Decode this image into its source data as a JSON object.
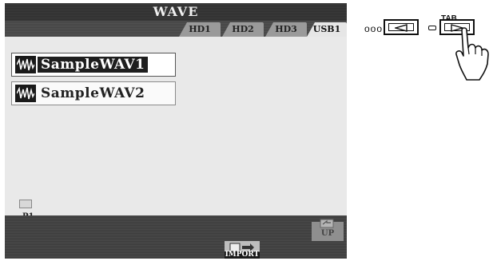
{
  "window": {
    "title": "WAVE"
  },
  "tabs": [
    "HD1",
    "HD2",
    "HD3",
    "USB1"
  ],
  "active_tab": "USB1",
  "files": [
    {
      "name": "SampleWAV1",
      "icon": "waveform-icon",
      "selected": true
    },
    {
      "name": "SampleWAV2",
      "icon": "waveform-icon",
      "selected": false
    }
  ],
  "page_tab": {
    "label": "P1"
  },
  "buttons": {
    "up_label": "UP",
    "import_label": "IMPORT"
  },
  "tab_control": {
    "caption": "TAB",
    "dots": "ooo"
  },
  "colors": {
    "screen_bg": "#3a3a3a",
    "content_bg": "#e9e9e9",
    "selected_bg": "#1e1e1e"
  }
}
